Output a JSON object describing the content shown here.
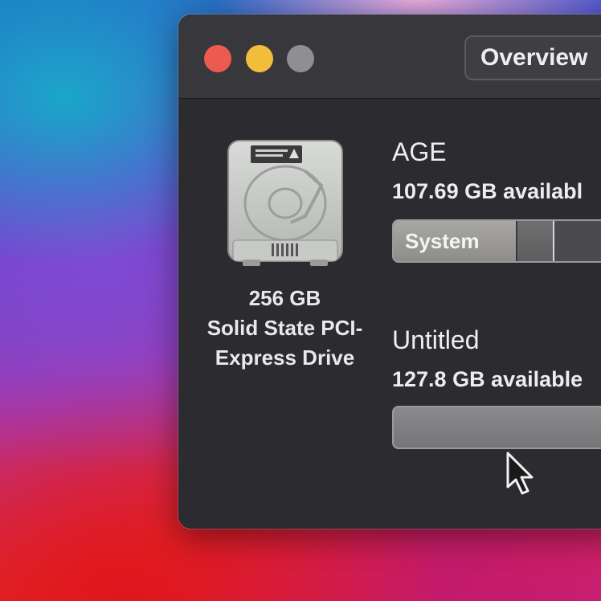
{
  "window": {
    "tab_overview": "Overview"
  },
  "drive": {
    "capacity": "256 GB",
    "name_line1": "Solid State PCI-",
    "name_line2": "Express Drive"
  },
  "volumes": [
    {
      "name": "AGE",
      "available": "107.69 GB availabl",
      "bar_label": "System",
      "system_fraction": 0.48,
      "other_fraction": 0.14
    },
    {
      "name": "Untitled",
      "available": "127.8 GB available"
    }
  ],
  "colors": {
    "close": "#ed5a51",
    "minimize": "#f2bd3a",
    "zoom": "#8f8e92",
    "window_bg": "#2c2b30"
  },
  "icons": {
    "drive": "hard-drive-icon",
    "cursor": "mouse-pointer-icon"
  }
}
